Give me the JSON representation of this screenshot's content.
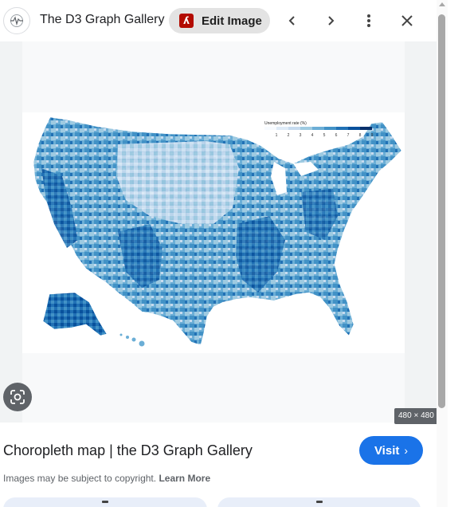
{
  "header": {
    "site_name": "The D3 Graph Gallery",
    "edit_image_label": "Edit Image",
    "pdf_icon_glyph": "ʎ",
    "logo_icon": "activity-icon",
    "prev_icon": "chevron-left-icon",
    "next_icon": "chevron-right-icon",
    "more_icon": "more-vert-icon",
    "close_icon": "close-icon"
  },
  "image": {
    "dimensions": "480 × 480",
    "legend_title": "Unemployment rate (%)",
    "legend_ticks": [
      "1",
      "2",
      "3",
      "4",
      "5",
      "6",
      "7",
      "8",
      "9"
    ],
    "lens_icon": "google-lens-icon"
  },
  "result": {
    "title": "Choropleth map | the D3 Graph Gallery",
    "visit_label": "Visit",
    "visit_chevron": "›",
    "copyright_text": "Images may be subject to copyright.",
    "learn_more_label": "Learn More"
  },
  "colors": {
    "accent": "#1a73e8",
    "map_light": "#deebf7",
    "map_dark": "#08306b",
    "pdf_red": "#b30b00"
  }
}
